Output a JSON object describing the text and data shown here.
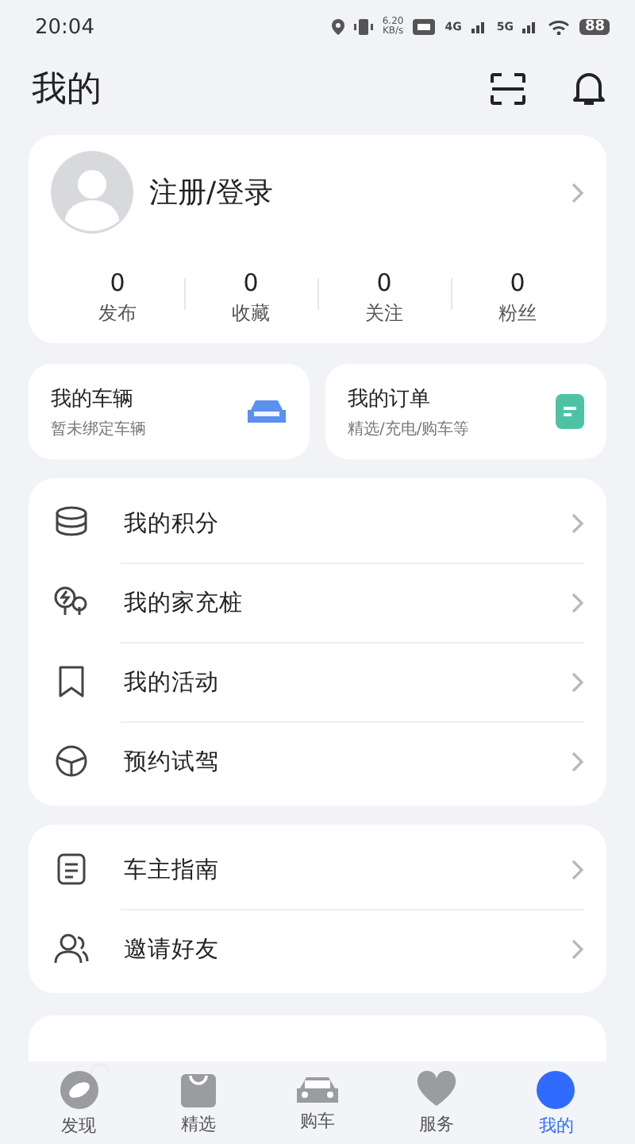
{
  "status_bar": {
    "time": "20:04",
    "speed": "6.20",
    "speed_unit": "KB/s",
    "network_1": "4G",
    "network_2": "5G",
    "battery": "88"
  },
  "header": {
    "title": "我的"
  },
  "profile": {
    "login": "注册/登录",
    "stats": [
      {
        "count": "0",
        "label": "发布"
      },
      {
        "count": "0",
        "label": "收藏"
      },
      {
        "count": "0",
        "label": "关注"
      },
      {
        "count": "0",
        "label": "粉丝"
      }
    ]
  },
  "shortcuts": [
    {
      "title": "我的车辆",
      "subtitle": "暂未绑定车辆"
    },
    {
      "title": "我的订单",
      "subtitle": "精选/充电/购车等"
    }
  ],
  "menu_groups": [
    {
      "items": [
        "我的积分",
        "我的家充桩",
        "我的活动",
        "预约试驾"
      ]
    },
    {
      "items": [
        "车主指南",
        "邀请好友"
      ]
    }
  ],
  "tab_bar": [
    {
      "label": "发现",
      "selected": false
    },
    {
      "label": "精选",
      "selected": false
    },
    {
      "label": "购车",
      "selected": false
    },
    {
      "label": "服务",
      "selected": false
    },
    {
      "label": "我的",
      "selected": true
    }
  ]
}
